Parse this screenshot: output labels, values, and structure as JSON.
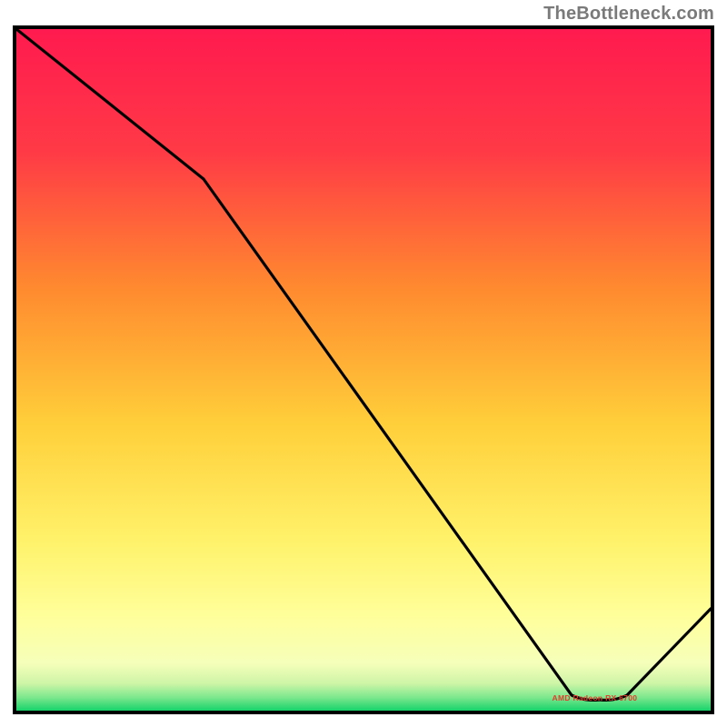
{
  "attribution": "TheBottleneck.com",
  "baseline_label": "AMD Radeon RX 6700",
  "colors": {
    "gradient_top": "#ff1a4f",
    "gradient_mid1": "#ff7a2e",
    "gradient_mid2": "#ffd23a",
    "gradient_mid3": "#ffff8a",
    "gradient_mid4": "#f7ffb0",
    "gradient_bottom": "#17d36b",
    "line": "#000000",
    "border": "#000000",
    "attribution": "#7a7a7a",
    "baseline_label": "#e63a2c"
  },
  "chart_data": {
    "type": "line",
    "title": "",
    "xlabel": "",
    "ylabel": "",
    "xlim": [
      0,
      100
    ],
    "ylim": [
      0,
      100
    ],
    "x": [
      0,
      27,
      80,
      82,
      84,
      86,
      88,
      100
    ],
    "values": [
      100,
      78,
      2.3,
      1.8,
      1.6,
      1.8,
      2.3,
      15
    ],
    "baseline_marker_x": 84,
    "notes": "Values estimated from pixel positions on a 0–100 normalized axis. Curve descends from top-left with a slope change near x≈27, reaches minimum near x≈84 at the green band, then rises toward the right edge."
  }
}
